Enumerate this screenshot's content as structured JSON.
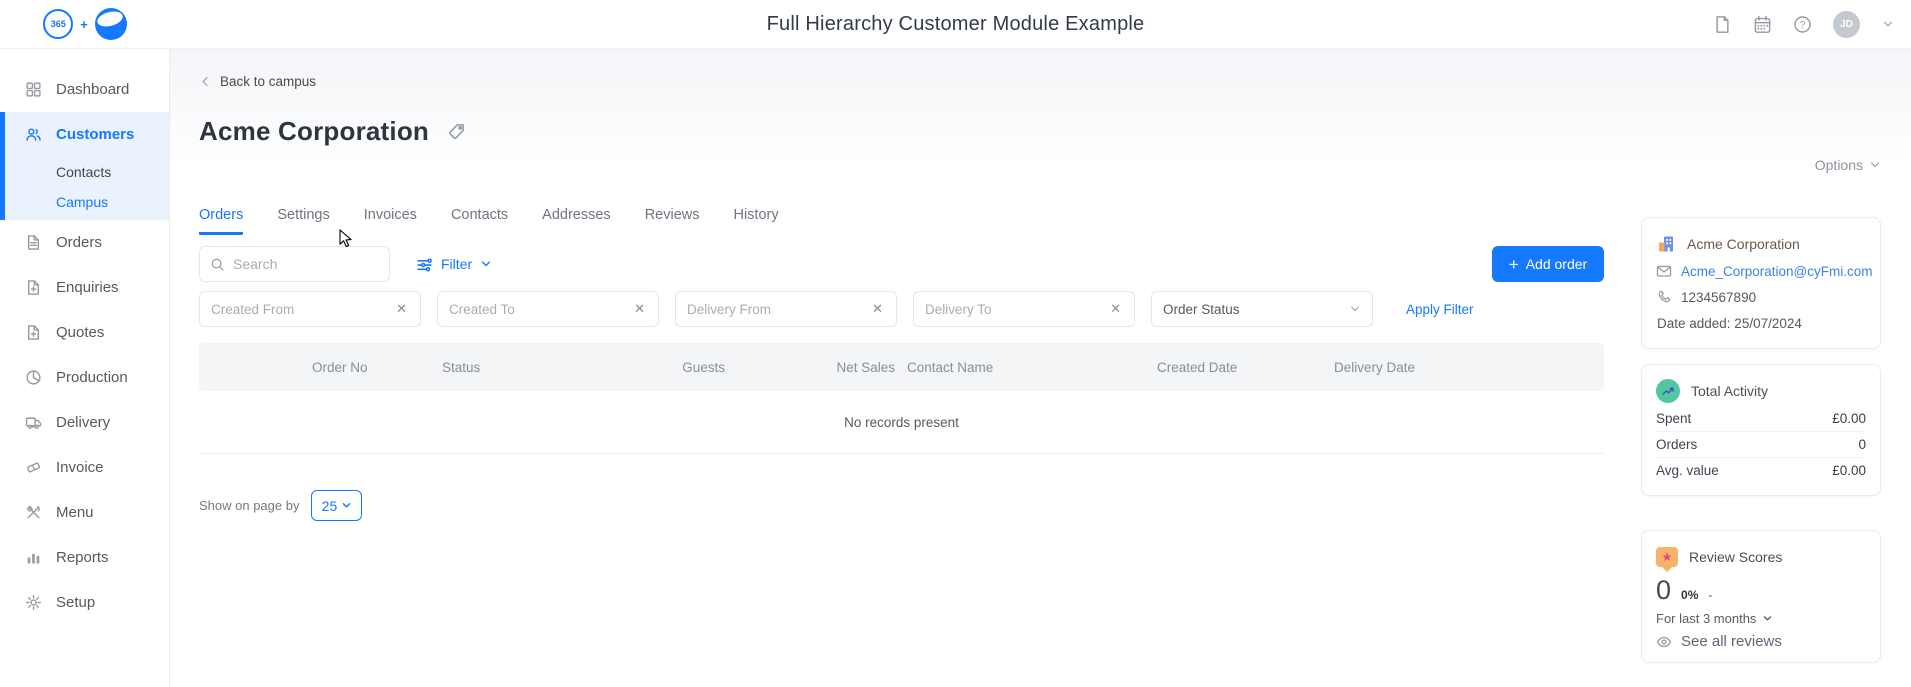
{
  "header": {
    "logo_badge": "365",
    "logo_plus": "+",
    "title": "Full Hierarchy Customer Module Example",
    "avatar_initials": "JD"
  },
  "sidebar": {
    "items": [
      {
        "label": "Dashboard"
      },
      {
        "label": "Customers"
      },
      {
        "label": "Contacts"
      },
      {
        "label": "Campus"
      },
      {
        "label": "Orders"
      },
      {
        "label": "Enquiries"
      },
      {
        "label": "Quotes"
      },
      {
        "label": "Production"
      },
      {
        "label": "Delivery"
      },
      {
        "label": "Invoice"
      },
      {
        "label": "Menu"
      },
      {
        "label": "Reports"
      },
      {
        "label": "Setup"
      }
    ]
  },
  "main": {
    "back_link": "Back to campus",
    "page_title": "Acme Corporation",
    "options_label": "Options",
    "tabs": [
      {
        "label": "Orders"
      },
      {
        "label": "Settings"
      },
      {
        "label": "Invoices"
      },
      {
        "label": "Contacts"
      },
      {
        "label": "Addresses"
      },
      {
        "label": "Reviews"
      },
      {
        "label": "History"
      }
    ],
    "search_placeholder": "Search",
    "filter_button_label": "Filter",
    "add_order_button": {
      "plus": "+",
      "label": "Add order"
    },
    "filter_fields": [
      {
        "placeholder": "Created From"
      },
      {
        "placeholder": "Created To"
      },
      {
        "placeholder": "Delivery From"
      },
      {
        "placeholder": "Delivery To"
      }
    ],
    "order_status_placeholder": "Order Status",
    "apply_filter_label": "Apply Filter",
    "table": {
      "columns": [
        "Order No",
        "Status",
        "Guests",
        "Net Sales",
        "Contact Name",
        "Created Date",
        "Delivery Date"
      ],
      "empty_message": "No records present"
    },
    "pagination": {
      "label": "Show on page by",
      "page_size": "25"
    }
  },
  "aside": {
    "customer_card": {
      "name": "Acme Corporation",
      "email": "Acme_Corporation@cyFmi.com",
      "phone": "1234567890",
      "date_added": "Date added: 25/07/2024"
    },
    "activity_card": {
      "title": "Total Activity",
      "rows": [
        {
          "label": "Spent",
          "value": "£0.00"
        },
        {
          "label": "Orders",
          "value": "0"
        },
        {
          "label": "Avg. value",
          "value": "£0.00"
        }
      ]
    },
    "review_card": {
      "title": "Review Scores",
      "score": "0",
      "percent_label": "0%",
      "dash": "-",
      "period_label": "For last 3 months",
      "see_all_label": "See all reviews"
    }
  },
  "icons": {
    "close": "✕",
    "question": "?",
    "star": "★"
  },
  "colors": {
    "primary": "#1677ff",
    "activity_green": "#52c6a0",
    "review_orange": "#f8b269",
    "star_pink": "#e8447e",
    "sidebar_active_bg": "#e9f2fd"
  }
}
